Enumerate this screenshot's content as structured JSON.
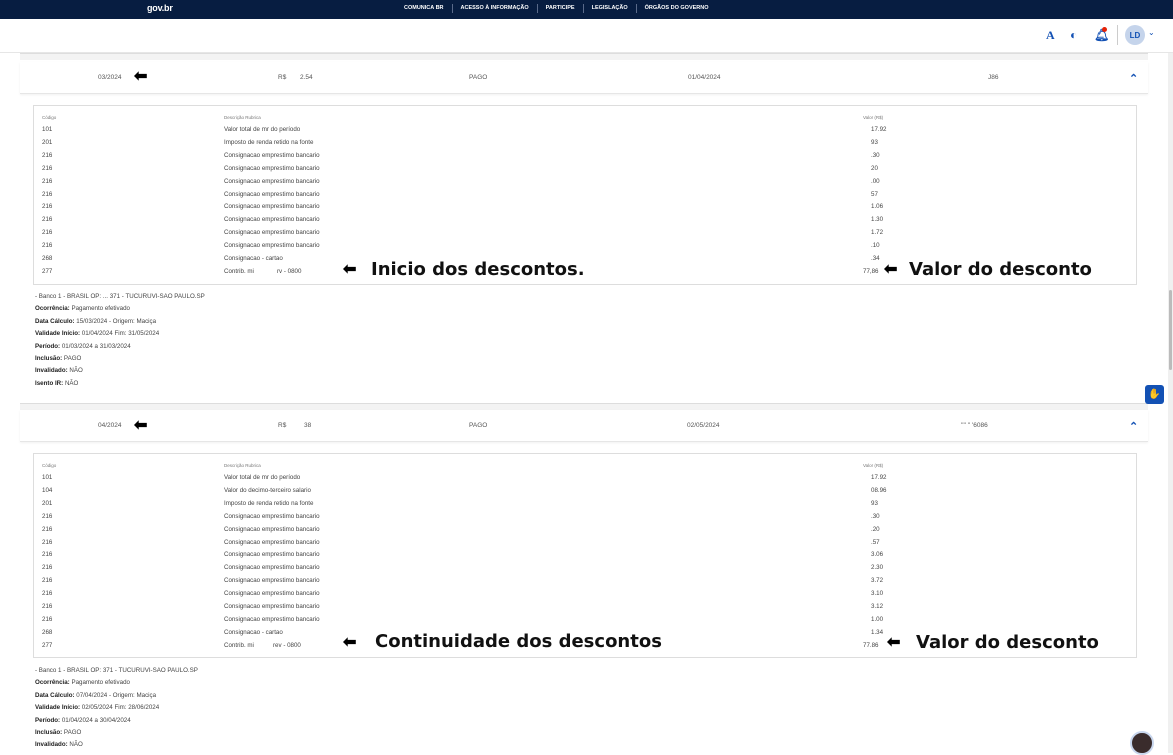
{
  "topbar": {
    "logo": "gov.br",
    "nav": [
      "COMUNICA BR",
      "ACESSO À INFORMAÇÃO",
      "PARTICIPE",
      "LEGISLAÇÃO",
      "ÓRGÃOS DO GOVERNO"
    ]
  },
  "header": {
    "font_icon": "A",
    "contrast_icon": "contrast-icon",
    "bell_icon": "bell-icon",
    "avatar": "LD"
  },
  "headers": {
    "codigo": "Código",
    "descricao": "Descrição Rubrica",
    "valor": "Valor (R$)"
  },
  "blocks": [
    {
      "summary": {
        "period": "03/2024",
        "currency": "R$",
        "amount": "2.54",
        "status": "PAGO",
        "date": "01/04/2024",
        "account": "J86"
      },
      "rows": [
        {
          "code": "101",
          "desc": "Valor total de mr do período",
          "value": "17.92"
        },
        {
          "code": "201",
          "desc": "Imposto de renda retido na fonte",
          "value": "93"
        },
        {
          "code": "216",
          "desc": "Consignacao emprestimo bancario",
          "value": ".30"
        },
        {
          "code": "216",
          "desc": "Consignacao emprestimo bancario",
          "value": "20"
        },
        {
          "code": "216",
          "desc": "Consignacao emprestimo bancario",
          "value": ".00"
        },
        {
          "code": "216",
          "desc": "Consignacao emprestimo bancario",
          "value": "57"
        },
        {
          "code": "216",
          "desc": "Consignacao emprestimo bancario",
          "value": "1.06"
        },
        {
          "code": "216",
          "desc": "Consignacao emprestimo bancario",
          "value": "1.30"
        },
        {
          "code": "216",
          "desc": "Consignacao emprestimo bancario",
          "value": "1.72"
        },
        {
          "code": "216",
          "desc": "Consignacao emprestimo bancario",
          "value": ".10"
        },
        {
          "code": "268",
          "desc": "Consignacao - cartao",
          "value": ".34"
        },
        {
          "code": "277",
          "desc": "Contrib. mi",
          "desc2": "rv - 0800",
          "value": "77,86"
        }
      ],
      "info": {
        "bank": "- Banco 1 - BRASIL OP: ... 371 - TUCURUVI-SAO PAULO.SP",
        "ocorrencia_label": "Ocorrência:",
        "ocorrencia": "Pagamento efetivado",
        "calculo_label": "Data Cálculo:",
        "calculo": "15/03/2024 - Origem: Maciça",
        "validade_label": "Validade Início:",
        "validade": "01/04/2024 Fim: 31/05/2024",
        "periodo_label": "Período:",
        "periodo": "01/03/2024 a 31/03/2024",
        "inclusao_label": "Inclusão:",
        "inclusao": "PAGO",
        "invalidado_label": "Invalidado:",
        "invalidado": "NÃO",
        "isento_label": "Isento IR:",
        "isento": "NÃO"
      },
      "annot_left": "Inicio dos descontos.",
      "annot_right": "Valor do desconto"
    },
    {
      "summary": {
        "period": "04/2024",
        "currency": "R$",
        "amount": "38",
        "status": "PAGO",
        "date": "02/05/2024",
        "account": "'''' '' '6086"
      },
      "rows": [
        {
          "code": "101",
          "desc": "Valor total de mr do período",
          "value": "17.92"
        },
        {
          "code": "104",
          "desc": "Valor do decimo-terceiro salario",
          "value": "08.96"
        },
        {
          "code": "201",
          "desc": "Imposto de renda retido na fonte",
          "value": "93"
        },
        {
          "code": "216",
          "desc": "Consignacao emprestimo bancario",
          "value": ".30"
        },
        {
          "code": "216",
          "desc": "Consignacao emprestimo bancario",
          "value": ".20"
        },
        {
          "code": "216",
          "desc": "Consignacao emprestimo bancario",
          "value": ".57"
        },
        {
          "code": "216",
          "desc": "Consignacao emprestimo bancario",
          "value": "3.06"
        },
        {
          "code": "216",
          "desc": "Consignacao emprestimo bancario",
          "value": "2.30"
        },
        {
          "code": "216",
          "desc": "Consignacao emprestimo bancario",
          "value": "3.72"
        },
        {
          "code": "216",
          "desc": "Consignacao emprestimo bancario",
          "value": "3.10"
        },
        {
          "code": "216",
          "desc": "Consignacao emprestimo bancario",
          "value": "3.12"
        },
        {
          "code": "216",
          "desc": "Consignacao emprestimo bancario",
          "value": "1.00"
        },
        {
          "code": "268",
          "desc": "Consignacao - cartao",
          "value": "1.34"
        },
        {
          "code": "277",
          "desc": "Contrib. mi",
          "desc2": "rev - 0800",
          "value": "77.86"
        }
      ],
      "info": {
        "bank": "- Banco 1 - BRASIL OP: 371 - TUCURUVI-SAO PAULO.SP",
        "ocorrencia_label": "Ocorrência:",
        "ocorrencia": "Pagamento efetivado",
        "calculo_label": "Data Cálculo:",
        "calculo": "07/04/2024 - Origem: Maciça",
        "validade_label": "Validade Início:",
        "validade": "02/05/2024 Fim: 28/06/2024",
        "periodo_label": "Período:",
        "periodo": "01/04/2024 a 30/04/2024",
        "inclusao_label": "Inclusão:",
        "inclusao": "PAGO",
        "invalidado_label": "Invalidado:",
        "invalidado": "NÃO"
      },
      "annot_left": "Continuidade dos descontos",
      "annot_right": "Valor do desconto"
    }
  ]
}
